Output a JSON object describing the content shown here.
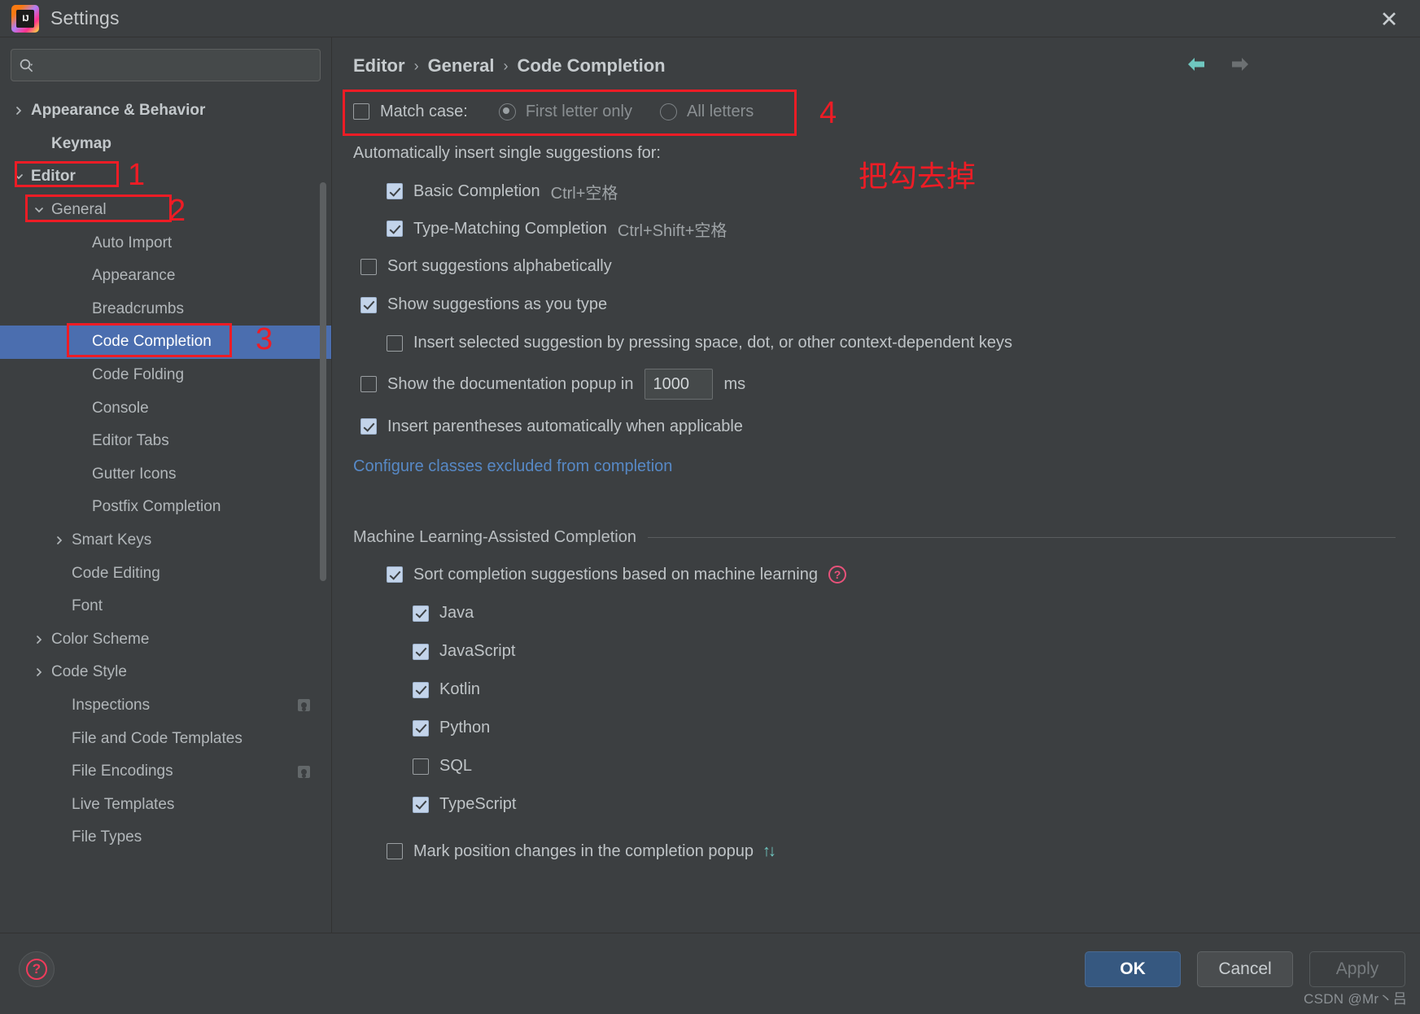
{
  "window": {
    "title": "Settings",
    "logo_text": "IJ",
    "close_label": "✕"
  },
  "sidebar": {
    "search_placeholder": "",
    "search_value": "",
    "items": [
      {
        "label": "Appearance & Behavior",
        "indent": 0,
        "chevron": "right",
        "bold": true,
        "selected": false,
        "badge": false
      },
      {
        "label": "Keymap",
        "indent": 1,
        "chevron": "none",
        "bold": true,
        "selected": false,
        "badge": false
      },
      {
        "label": "Editor",
        "indent": 0,
        "chevron": "down",
        "bold": true,
        "selected": false,
        "badge": false
      },
      {
        "label": "General",
        "indent": 1,
        "chevron": "down",
        "bold": false,
        "selected": false,
        "badge": false
      },
      {
        "label": "Auto Import",
        "indent": 3,
        "chevron": "none",
        "bold": false,
        "selected": false,
        "badge": false
      },
      {
        "label": "Appearance",
        "indent": 3,
        "chevron": "none",
        "bold": false,
        "selected": false,
        "badge": false
      },
      {
        "label": "Breadcrumbs",
        "indent": 3,
        "chevron": "none",
        "bold": false,
        "selected": false,
        "badge": false
      },
      {
        "label": "Code Completion",
        "indent": 3,
        "chevron": "none",
        "bold": false,
        "selected": true,
        "badge": false
      },
      {
        "label": "Code Folding",
        "indent": 3,
        "chevron": "none",
        "bold": false,
        "selected": false,
        "badge": false
      },
      {
        "label": "Console",
        "indent": 3,
        "chevron": "none",
        "bold": false,
        "selected": false,
        "badge": false
      },
      {
        "label": "Editor Tabs",
        "indent": 3,
        "chevron": "none",
        "bold": false,
        "selected": false,
        "badge": false
      },
      {
        "label": "Gutter Icons",
        "indent": 3,
        "chevron": "none",
        "bold": false,
        "selected": false,
        "badge": false
      },
      {
        "label": "Postfix Completion",
        "indent": 3,
        "chevron": "none",
        "bold": false,
        "selected": false,
        "badge": false
      },
      {
        "label": "Smart Keys",
        "indent": 2,
        "chevron": "right",
        "bold": false,
        "selected": false,
        "badge": false
      },
      {
        "label": "Code Editing",
        "indent": 2,
        "chevron": "none",
        "bold": false,
        "selected": false,
        "badge": false
      },
      {
        "label": "Font",
        "indent": 2,
        "chevron": "none",
        "bold": false,
        "selected": false,
        "badge": false
      },
      {
        "label": "Color Scheme",
        "indent": 1,
        "chevron": "right",
        "bold": false,
        "selected": false,
        "badge": false
      },
      {
        "label": "Code Style",
        "indent": 1,
        "chevron": "right",
        "bold": false,
        "selected": false,
        "badge": false
      },
      {
        "label": "Inspections",
        "indent": 2,
        "chevron": "none",
        "bold": false,
        "selected": false,
        "badge": true
      },
      {
        "label": "File and Code Templates",
        "indent": 2,
        "chevron": "none",
        "bold": false,
        "selected": false,
        "badge": false
      },
      {
        "label": "File Encodings",
        "indent": 2,
        "chevron": "none",
        "bold": false,
        "selected": false,
        "badge": true
      },
      {
        "label": "Live Templates",
        "indent": 2,
        "chevron": "none",
        "bold": false,
        "selected": false,
        "badge": false
      },
      {
        "label": "File Types",
        "indent": 2,
        "chevron": "none",
        "bold": false,
        "selected": false,
        "badge": false
      }
    ]
  },
  "breadcrumb": {
    "part1": "Editor",
    "sep1": "›",
    "part2": "General",
    "sep2": "›",
    "part3": "Code Completion"
  },
  "nav": {
    "back_color": "#6fc7c0",
    "forward_color": "#6c7072"
  },
  "settings": {
    "match_case": {
      "label": "Match case:",
      "checked": false
    },
    "match_case_options": [
      {
        "label": "First letter only",
        "selected": true
      },
      {
        "label": "All letters",
        "selected": false
      }
    ],
    "auto_insert_header": "Automatically insert single suggestions for:",
    "auto_insert_items": [
      {
        "label": "Basic Completion",
        "shortcut": "Ctrl+空格",
        "checked": true
      },
      {
        "label": "Type-Matching Completion",
        "shortcut": "Ctrl+Shift+空格",
        "checked": true
      }
    ],
    "sort_alphabetically": {
      "label": "Sort suggestions alphabetically",
      "checked": false
    },
    "show_as_you_type": {
      "label": "Show suggestions as you type",
      "checked": true
    },
    "insert_selected": {
      "label": "Insert selected suggestion by pressing space, dot, or other context-dependent keys",
      "checked": false
    },
    "doc_popup": {
      "label": "Show the documentation popup in",
      "checked": false,
      "value": "1000",
      "unit": "ms"
    },
    "insert_parens": {
      "label": "Insert parentheses automatically when applicable",
      "checked": true
    },
    "configure_link": "Configure classes excluded from completion",
    "ml_section_title": "Machine Learning-Assisted Completion",
    "ml_sort": {
      "label": "Sort completion suggestions based on machine learning",
      "checked": true,
      "help": "?"
    },
    "ml_languages": [
      {
        "label": "Java",
        "checked": true
      },
      {
        "label": "JavaScript",
        "checked": true
      },
      {
        "label": "Kotlin",
        "checked": true
      },
      {
        "label": "Python",
        "checked": true
      },
      {
        "label": "SQL",
        "checked": false
      },
      {
        "label": "TypeScript",
        "checked": true
      }
    ],
    "mark_position": {
      "label": "Mark position changes in the completion popup",
      "checked": false,
      "icon": "↑↓"
    }
  },
  "footer": {
    "ok": "OK",
    "cancel": "Cancel",
    "apply": "Apply",
    "help": "?",
    "watermark": "CSDN @Mr丶吕"
  },
  "annotations": {
    "marker_1": "1",
    "marker_2": "2",
    "marker_3": "3",
    "marker_4": "4",
    "note": "把勾去掉",
    "color": "#ee1c25"
  }
}
